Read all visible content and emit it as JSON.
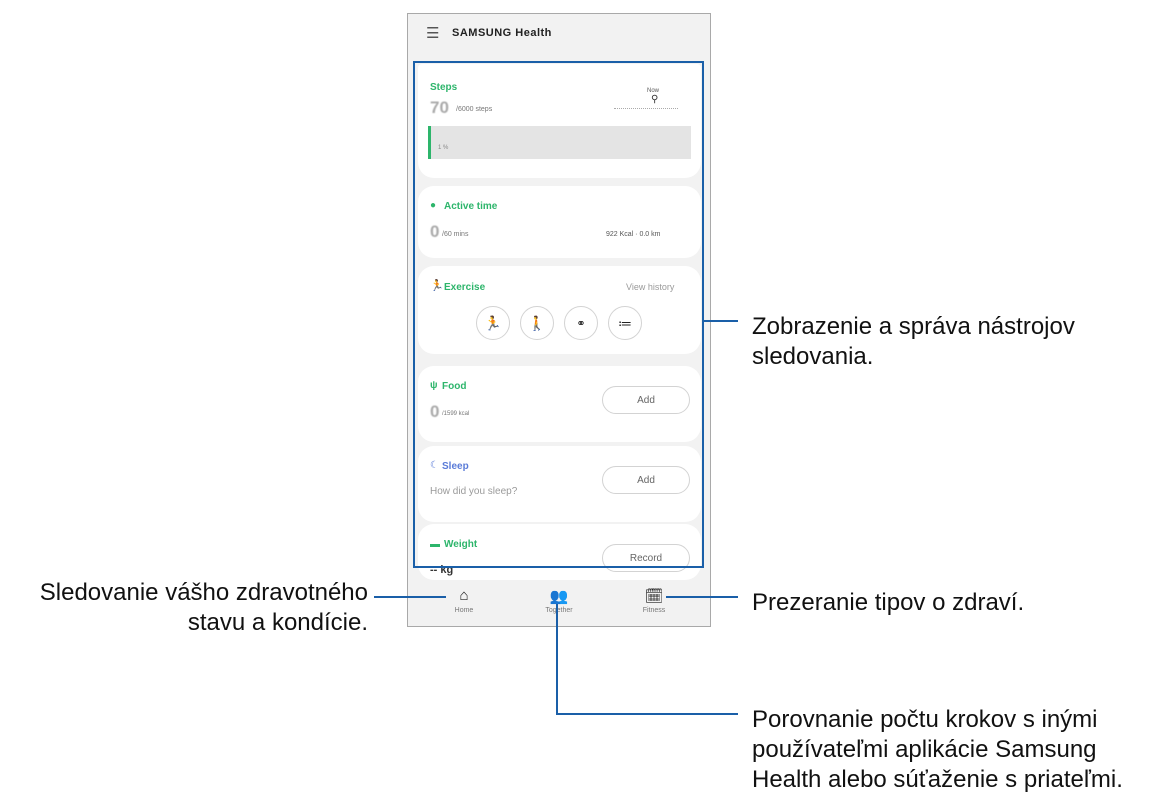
{
  "app": {
    "title": "SAMSUNG Health",
    "menu_icon": "hamburger-menu-icon"
  },
  "steps": {
    "title": "Steps",
    "value": "70",
    "goal_text": "/6000 steps",
    "marker_label": "Now",
    "progress_text": "1 %",
    "progress_fraction": 0.01
  },
  "active_time": {
    "title": "Active time",
    "value": "0",
    "goal_text": "/60 mins",
    "stats_text": "922 Kcal · 0.0 km"
  },
  "exercise": {
    "title": "Exercise",
    "link": "View history",
    "buttons": [
      "running-icon",
      "walking-icon",
      "cycling-icon",
      "list-icon"
    ]
  },
  "food": {
    "title": "Food",
    "value": "0",
    "goal_text": "/1599 kcal",
    "button": "Add"
  },
  "sleep": {
    "title": "Sleep",
    "prompt": "How did you sleep?",
    "button": "Add"
  },
  "weight": {
    "title": "Weight",
    "value": "-- kg",
    "button": "Record"
  },
  "nav": [
    {
      "label": "Home",
      "icon": "home-icon"
    },
    {
      "label": "Together",
      "icon": "people-icon"
    },
    {
      "label": "Fitness",
      "icon": "calendar-play-icon"
    }
  ],
  "callouts": {
    "trackers": "Zobrazenie a správa nástrojov sledovania.",
    "home": "Sledovanie vášho zdravotného stavu a kondície.",
    "fitness": "Prezeranie tipov o zdraví.",
    "together": "Porovnanie počtu krokov s inými používateľmi aplikácie Samsung Health alebo súťaženie s priateľmi."
  },
  "colors": {
    "accent_green": "#2db56b",
    "callout_blue": "#1a5fa8",
    "sleep_blue": "#5a7bd8"
  }
}
